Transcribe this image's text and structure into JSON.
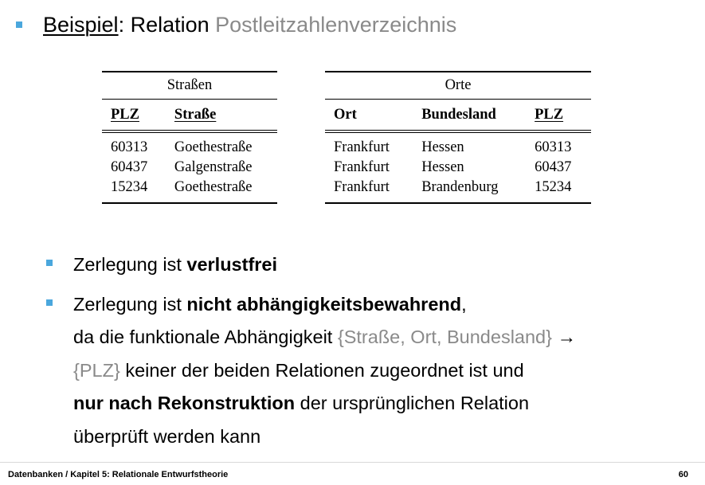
{
  "title": {
    "underlined": "Beispiel",
    "rest": ": Relation ",
    "gray": "Postleitzahlenverzeichnis"
  },
  "tables": {
    "strassen": {
      "caption": "Straßen",
      "headers": [
        "PLZ",
        "Straße"
      ],
      "rows": [
        [
          "60313",
          "Goethestraße"
        ],
        [
          "60437",
          "Galgenstraße"
        ],
        [
          "15234",
          "Goethestraße"
        ]
      ]
    },
    "orte": {
      "caption": "Orte",
      "headers": [
        "Ort",
        "Bundesland",
        "PLZ"
      ],
      "rows": [
        [
          "Frankfurt",
          "Hessen",
          "60313"
        ],
        [
          "Frankfurt",
          "Hessen",
          "60437"
        ],
        [
          "Frankfurt",
          "Brandenburg",
          "15234"
        ]
      ]
    }
  },
  "bullets": {
    "b1": {
      "text": "Zerlegung ist ",
      "bold": "verlustfrei"
    },
    "b2": {
      "text1": "Zerlegung ist ",
      "bold1": "nicht abhängigkeitsbewahrend",
      "text2": ",",
      "line2": "da die funktionale Abhängigkeit ",
      "gray1": "{Straße, Ort, Bundesland}",
      "arrow": " →",
      "gray2": "{PLZ}",
      "text3": " keiner der beiden Relationen zugeordnet ist und",
      "bold2": "nur nach Rekonstruktion",
      "text4": " der ursprünglichen Relation",
      "text5": "überprüft werden kann"
    }
  },
  "footer": {
    "left": "Datenbanken / Kapitel 5: Relationale Entwurfstheorie",
    "page": "60"
  },
  "colors": {
    "bullet": "#4aa7dd",
    "gray_text": "#8a8a8a"
  }
}
